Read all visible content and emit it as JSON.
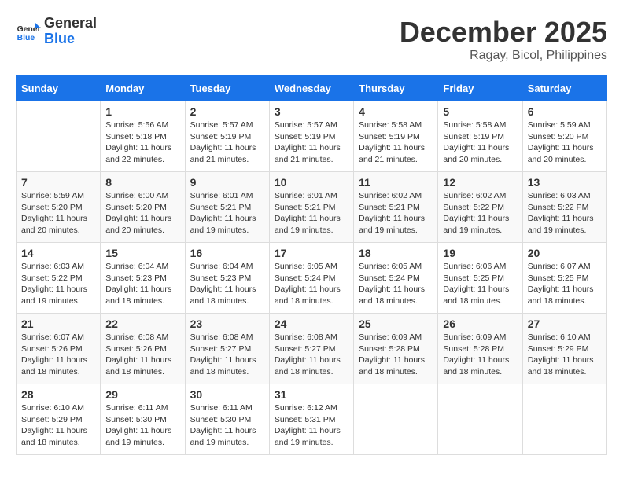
{
  "header": {
    "logo_general": "General",
    "logo_blue": "Blue",
    "month": "December 2025",
    "location": "Ragay, Bicol, Philippines"
  },
  "weekdays": [
    "Sunday",
    "Monday",
    "Tuesday",
    "Wednesday",
    "Thursday",
    "Friday",
    "Saturday"
  ],
  "weeks": [
    [
      {
        "day": "",
        "info": ""
      },
      {
        "day": "1",
        "info": "Sunrise: 5:56 AM\nSunset: 5:18 PM\nDaylight: 11 hours\nand 22 minutes."
      },
      {
        "day": "2",
        "info": "Sunrise: 5:57 AM\nSunset: 5:19 PM\nDaylight: 11 hours\nand 21 minutes."
      },
      {
        "day": "3",
        "info": "Sunrise: 5:57 AM\nSunset: 5:19 PM\nDaylight: 11 hours\nand 21 minutes."
      },
      {
        "day": "4",
        "info": "Sunrise: 5:58 AM\nSunset: 5:19 PM\nDaylight: 11 hours\nand 21 minutes."
      },
      {
        "day": "5",
        "info": "Sunrise: 5:58 AM\nSunset: 5:19 PM\nDaylight: 11 hours\nand 20 minutes."
      },
      {
        "day": "6",
        "info": "Sunrise: 5:59 AM\nSunset: 5:20 PM\nDaylight: 11 hours\nand 20 minutes."
      }
    ],
    [
      {
        "day": "7",
        "info": "Sunrise: 5:59 AM\nSunset: 5:20 PM\nDaylight: 11 hours\nand 20 minutes."
      },
      {
        "day": "8",
        "info": "Sunrise: 6:00 AM\nSunset: 5:20 PM\nDaylight: 11 hours\nand 20 minutes."
      },
      {
        "day": "9",
        "info": "Sunrise: 6:01 AM\nSunset: 5:21 PM\nDaylight: 11 hours\nand 19 minutes."
      },
      {
        "day": "10",
        "info": "Sunrise: 6:01 AM\nSunset: 5:21 PM\nDaylight: 11 hours\nand 19 minutes."
      },
      {
        "day": "11",
        "info": "Sunrise: 6:02 AM\nSunset: 5:21 PM\nDaylight: 11 hours\nand 19 minutes."
      },
      {
        "day": "12",
        "info": "Sunrise: 6:02 AM\nSunset: 5:22 PM\nDaylight: 11 hours\nand 19 minutes."
      },
      {
        "day": "13",
        "info": "Sunrise: 6:03 AM\nSunset: 5:22 PM\nDaylight: 11 hours\nand 19 minutes."
      }
    ],
    [
      {
        "day": "14",
        "info": "Sunrise: 6:03 AM\nSunset: 5:22 PM\nDaylight: 11 hours\nand 19 minutes."
      },
      {
        "day": "15",
        "info": "Sunrise: 6:04 AM\nSunset: 5:23 PM\nDaylight: 11 hours\nand 18 minutes."
      },
      {
        "day": "16",
        "info": "Sunrise: 6:04 AM\nSunset: 5:23 PM\nDaylight: 11 hours\nand 18 minutes."
      },
      {
        "day": "17",
        "info": "Sunrise: 6:05 AM\nSunset: 5:24 PM\nDaylight: 11 hours\nand 18 minutes."
      },
      {
        "day": "18",
        "info": "Sunrise: 6:05 AM\nSunset: 5:24 PM\nDaylight: 11 hours\nand 18 minutes."
      },
      {
        "day": "19",
        "info": "Sunrise: 6:06 AM\nSunset: 5:25 PM\nDaylight: 11 hours\nand 18 minutes."
      },
      {
        "day": "20",
        "info": "Sunrise: 6:07 AM\nSunset: 5:25 PM\nDaylight: 11 hours\nand 18 minutes."
      }
    ],
    [
      {
        "day": "21",
        "info": "Sunrise: 6:07 AM\nSunset: 5:26 PM\nDaylight: 11 hours\nand 18 minutes."
      },
      {
        "day": "22",
        "info": "Sunrise: 6:08 AM\nSunset: 5:26 PM\nDaylight: 11 hours\nand 18 minutes."
      },
      {
        "day": "23",
        "info": "Sunrise: 6:08 AM\nSunset: 5:27 PM\nDaylight: 11 hours\nand 18 minutes."
      },
      {
        "day": "24",
        "info": "Sunrise: 6:08 AM\nSunset: 5:27 PM\nDaylight: 11 hours\nand 18 minutes."
      },
      {
        "day": "25",
        "info": "Sunrise: 6:09 AM\nSunset: 5:28 PM\nDaylight: 11 hours\nand 18 minutes."
      },
      {
        "day": "26",
        "info": "Sunrise: 6:09 AM\nSunset: 5:28 PM\nDaylight: 11 hours\nand 18 minutes."
      },
      {
        "day": "27",
        "info": "Sunrise: 6:10 AM\nSunset: 5:29 PM\nDaylight: 11 hours\nand 18 minutes."
      }
    ],
    [
      {
        "day": "28",
        "info": "Sunrise: 6:10 AM\nSunset: 5:29 PM\nDaylight: 11 hours\nand 18 minutes."
      },
      {
        "day": "29",
        "info": "Sunrise: 6:11 AM\nSunset: 5:30 PM\nDaylight: 11 hours\nand 19 minutes."
      },
      {
        "day": "30",
        "info": "Sunrise: 6:11 AM\nSunset: 5:30 PM\nDaylight: 11 hours\nand 19 minutes."
      },
      {
        "day": "31",
        "info": "Sunrise: 6:12 AM\nSunset: 5:31 PM\nDaylight: 11 hours\nand 19 minutes."
      },
      {
        "day": "",
        "info": ""
      },
      {
        "day": "",
        "info": ""
      },
      {
        "day": "",
        "info": ""
      }
    ]
  ]
}
